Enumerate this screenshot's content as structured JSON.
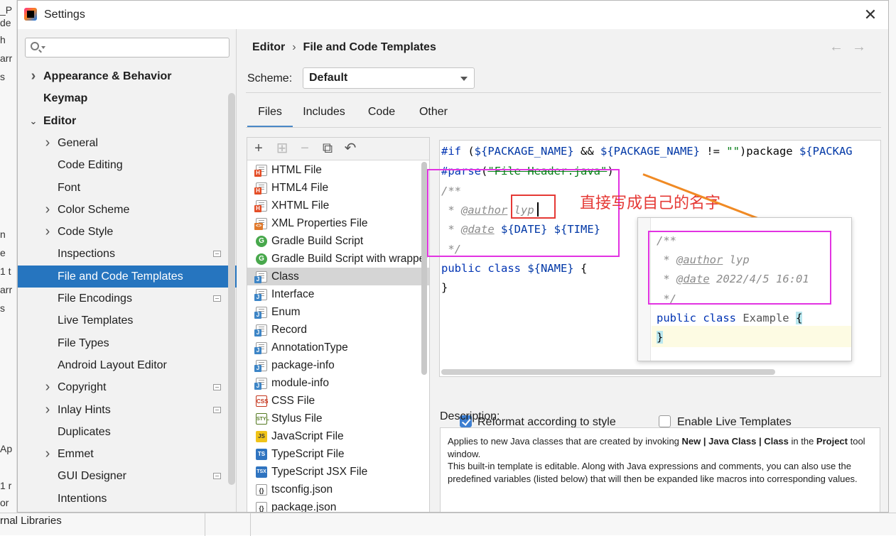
{
  "window": {
    "title": "Settings",
    "close_icon": "close-icon"
  },
  "search": {
    "placeholder": ""
  },
  "background": {
    "libs_label": "rnal Libraries"
  },
  "sidebar": {
    "items": [
      {
        "label": "Appearance & Behavior",
        "bold": true,
        "chevron": "right"
      },
      {
        "label": "Keymap",
        "bold": true
      },
      {
        "label": "Editor",
        "bold": true,
        "chevron": "down"
      },
      {
        "label": "General",
        "chevron": "right"
      },
      {
        "label": "Code Editing"
      },
      {
        "label": "Font"
      },
      {
        "label": "Color Scheme",
        "chevron": "right"
      },
      {
        "label": "Code Style",
        "chevron": "right"
      },
      {
        "label": "Inspections",
        "badge": true
      },
      {
        "label": "File and Code Templates",
        "selected": true
      },
      {
        "label": "File Encodings",
        "badge": true
      },
      {
        "label": "Live Templates"
      },
      {
        "label": "File Types"
      },
      {
        "label": "Android Layout Editor"
      },
      {
        "label": "Copyright",
        "chevron": "right",
        "badge": true
      },
      {
        "label": "Inlay Hints",
        "chevron": "right",
        "badge": true
      },
      {
        "label": "Duplicates"
      },
      {
        "label": "Emmet",
        "chevron": "right"
      },
      {
        "label": "GUI Designer",
        "badge": true
      },
      {
        "label": "Intentions"
      }
    ]
  },
  "header": {
    "breadcrumb_parent": "Editor",
    "breadcrumb_sep": "›",
    "breadcrumb_current": "File and Code Templates",
    "back_arrow": "←",
    "forward_arrow": "→"
  },
  "scheme": {
    "label": "Scheme:",
    "value": "Default"
  },
  "tabs": [
    {
      "label": "Files",
      "active": true
    },
    {
      "label": "Includes"
    },
    {
      "label": "Code"
    },
    {
      "label": "Other"
    }
  ],
  "toolbar": {
    "add": "+",
    "add_child": "⊞",
    "remove": "−",
    "copy": "⧉",
    "reset": "↶"
  },
  "templates": [
    {
      "name": "HTML File",
      "icon": "h"
    },
    {
      "name": "HTML4 File",
      "icon": "h"
    },
    {
      "name": "XHTML File",
      "icon": "h"
    },
    {
      "name": "XML Properties File",
      "icon": "x"
    },
    {
      "name": "Gradle Build Script",
      "icon": "g"
    },
    {
      "name": "Gradle Build Script with wrapper",
      "icon": "g"
    },
    {
      "name": "Class",
      "icon": "j",
      "selected": true
    },
    {
      "name": "Interface",
      "icon": "j"
    },
    {
      "name": "Enum",
      "icon": "j"
    },
    {
      "name": "Record",
      "icon": "j"
    },
    {
      "name": "AnnotationType",
      "icon": "j"
    },
    {
      "name": "package-info",
      "icon": "j"
    },
    {
      "name": "module-info",
      "icon": "j"
    },
    {
      "name": "CSS File",
      "icon": "css",
      "icon_text": "CSS"
    },
    {
      "name": "Stylus File",
      "icon": "styl",
      "icon_text": "STYL"
    },
    {
      "name": "JavaScript File",
      "icon": "js",
      "icon_text": "JS"
    },
    {
      "name": "TypeScript File",
      "icon": "ts",
      "icon_text": "TS"
    },
    {
      "name": "TypeScript JSX File",
      "icon": "tsx",
      "icon_text": "TSX"
    },
    {
      "name": "tsconfig.json",
      "icon": "json",
      "icon_text": "{}"
    },
    {
      "name": "package.json",
      "icon": "json",
      "icon_text": "{}"
    }
  ],
  "editor": {
    "line1_if": "#if",
    "line1_a": " (",
    "line1_var1": "${PACKAGE_NAME}",
    "line1_b": " && ",
    "line1_var2": "${PACKAGE_NAME}",
    "line1_c": " != ",
    "line1_str": "\"\"",
    "line1_d": ")package ",
    "line1_var3": "${PACKAG",
    "line2_kw": "#parse",
    "line2_a": "(",
    "line2_str": "\"File Header.java\"",
    "line2_b": ")",
    "line3": "/**",
    "line4_prefix": " * ",
    "line4_tag": "@author",
    "line4_val": " lyp",
    "line5_prefix": " * ",
    "line5_tag": "@date",
    "line5_var1": " ${DATE}",
    "line5_var2": " ${TIME}",
    "line6": " */",
    "line7_kw": "public class",
    "line7_var": " ${NAME}",
    "line7_tail": " {",
    "line8": "}"
  },
  "annotation": {
    "text": "直接写成自己的名字",
    "color": "#e53935",
    "box_color": "#e233e2",
    "arrow_color": "#f08a24"
  },
  "preview": {
    "line1": "/**",
    "line2_prefix": " * ",
    "line2_tag": "@author",
    "line2_val": " lyp",
    "line3_prefix": " * ",
    "line3_tag": "@date",
    "line3_val": " 2022/4/5 16:01",
    "line4": " */",
    "line5_kw": "public class",
    "line5_name": " Example ",
    "line5_brace": "{",
    "line6": "}"
  },
  "options": {
    "reformat_label": "Reformat according to style",
    "reformat_checked": true,
    "live_label": "Enable Live Templates",
    "live_checked": false
  },
  "description": {
    "label": "Description:",
    "p1_a": "Applies to new Java classes that are created by invoking ",
    "p1_b": "New | Java Class | Class",
    "p1_c": " in the ",
    "p1_d": "Project",
    "p1_e": " tool window.",
    "p2": "This built-in template is editable. Along with Java expressions and comments, you can also use the predefined variables (listed below) that will then be expanded like macros into corresponding values."
  }
}
